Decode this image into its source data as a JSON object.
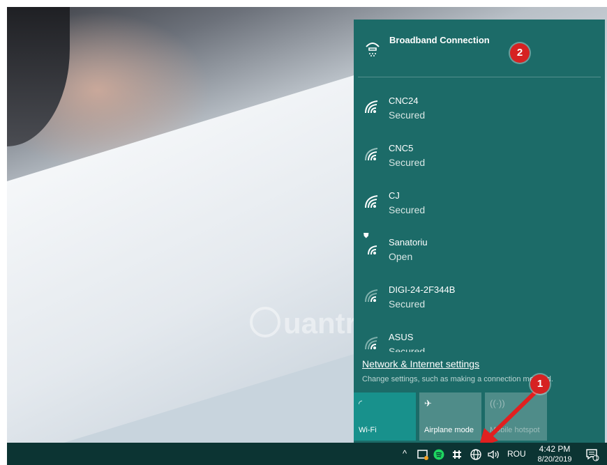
{
  "flyout": {
    "broadband_label": "Broadband Connection",
    "networks": [
      {
        "ssid": "CNC24",
        "status": "Secured"
      },
      {
        "ssid": "CNC5",
        "status": "Secured"
      },
      {
        "ssid": "CJ",
        "status": "Secured"
      },
      {
        "ssid": "Sanatoriu",
        "status": "Open"
      },
      {
        "ssid": "DIGI-24-2F344B",
        "status": "Secured"
      },
      {
        "ssid": "ASUS",
        "status": "Secured"
      }
    ],
    "settings_link": "Network & Internet settings",
    "settings_subtext": "Change settings, such as making a connection metered.",
    "tiles": [
      {
        "label": "Wi-Fi"
      },
      {
        "label": "Airplane mode"
      },
      {
        "label": "Mobile hotspot"
      }
    ]
  },
  "callouts": {
    "one": "1",
    "two": "2"
  },
  "watermark": "uantrimang",
  "taskbar": {
    "language": "ROU",
    "time": "4:42 PM",
    "date": "8/20/2019",
    "notification_count": "1"
  },
  "colors": {
    "flyout_bg": "#1c6b68",
    "wifi_tile": "#18918c",
    "tile": "#4f8c89",
    "taskbar": "#0c3433",
    "callout": "#d62222"
  }
}
